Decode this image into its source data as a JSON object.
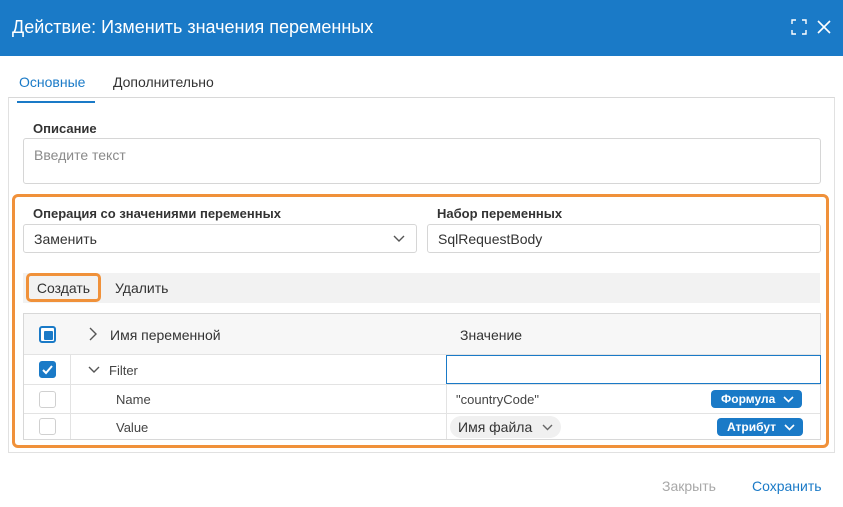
{
  "dialog": {
    "title": "Действие: Изменить значения переменных"
  },
  "tabs": [
    {
      "label": "Основные",
      "active": true
    },
    {
      "label": "Дополнительно",
      "active": false
    }
  ],
  "description": {
    "label": "Описание",
    "placeholder": "Введите текст"
  },
  "operation": {
    "label": "Операция со значениями переменных",
    "value": "Заменить"
  },
  "variable_set": {
    "label": "Набор переменных",
    "value": "SqlRequestBody"
  },
  "toolbar": {
    "create_label": "Создать",
    "delete_label": "Удалить"
  },
  "grid": {
    "columns": [
      "Имя переменной",
      "Значение"
    ],
    "rows": [
      {
        "name": "Filter",
        "value": "",
        "checked": true
      },
      {
        "name": "Name",
        "value": "\"countryCode\"",
        "type": "Формула",
        "checked": false
      },
      {
        "name": "Value",
        "value": "Имя файла",
        "type": "Атрибут",
        "checked": false
      }
    ]
  },
  "footer": {
    "close_label": "Закрыть",
    "save_label": "Сохранить"
  },
  "colors": {
    "accent": "#1a7ac7",
    "highlight": "#f0913a"
  }
}
